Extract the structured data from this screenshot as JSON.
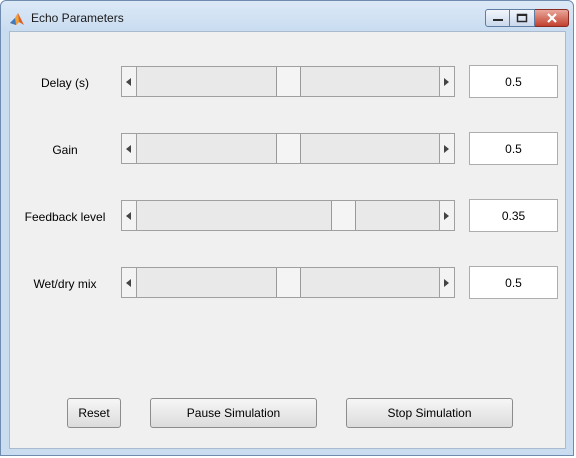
{
  "window": {
    "title": "Echo Parameters",
    "icon": "matlab-icon"
  },
  "controls": {
    "minimize": "minimize-icon",
    "maximize": "maximize-icon",
    "close": "close-icon"
  },
  "params": [
    {
      "label": "Delay (s)",
      "value": "0.5",
      "level": 0.5
    },
    {
      "label": "Gain",
      "value": "0.5",
      "level": 0.5
    },
    {
      "label": "Feedback level",
      "value": "0.35",
      "level": 0.7
    },
    {
      "label": "Wet/dry mix",
      "value": "0.5",
      "level": 0.5
    }
  ],
  "buttons": {
    "reset": "Reset",
    "pause": "Pause Simulation",
    "stop": "Stop Simulation"
  }
}
